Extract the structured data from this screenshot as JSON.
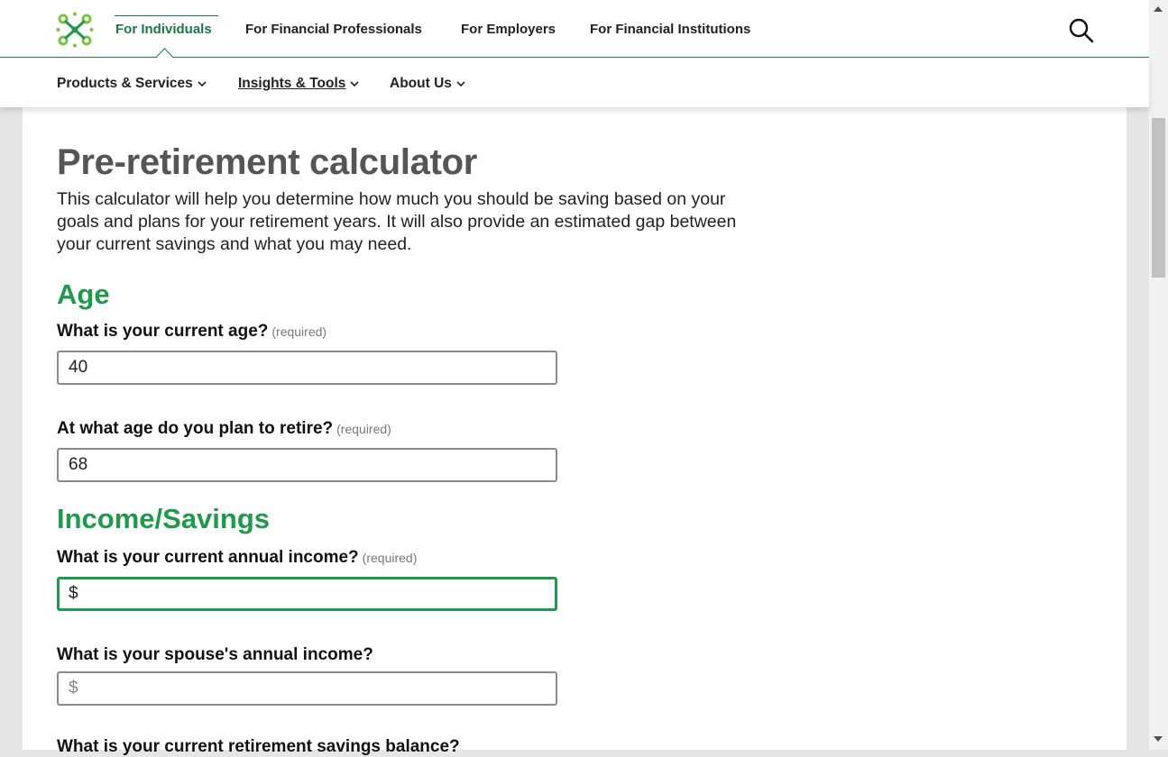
{
  "header": {
    "logo_icon": "green-cross-logo-icon",
    "audience_tabs": [
      {
        "label": "For Individuals",
        "active": true
      },
      {
        "label": "For Financial Professionals"
      },
      {
        "label": "For Employers"
      },
      {
        "label": "For Financial Institutions"
      }
    ],
    "search_icon": "search-icon"
  },
  "subnav": {
    "items": [
      {
        "label": "Products & Services"
      },
      {
        "label": "Insights & Tools",
        "current": true
      },
      {
        "label": "About Us"
      }
    ]
  },
  "page": {
    "title": "Pre-retirement calculator",
    "intro": "This calculator will help you determine how much you should be saving based on your goals and plans for your retirement years. It will also provide an estimated gap between your current savings and what you may need."
  },
  "sections": {
    "age": {
      "heading": "Age",
      "current_age": {
        "label": "What is your current age?",
        "required": "(required)",
        "value": "40"
      },
      "retire_age": {
        "label": "At what age do you plan to retire?",
        "required": "(required)",
        "value": "68"
      }
    },
    "income": {
      "heading": "Income/Savings",
      "annual_income": {
        "label": "What is your current annual income?",
        "required": "(required)",
        "placeholder": "$"
      },
      "spouse_income": {
        "label": "What is your spouse's annual income?",
        "placeholder": "$"
      },
      "savings_balance": {
        "label": "What is your current retirement savings balance?"
      }
    }
  },
  "colors": {
    "brand_green": "#1f9a4d",
    "nav_green": "#1a7a45"
  }
}
